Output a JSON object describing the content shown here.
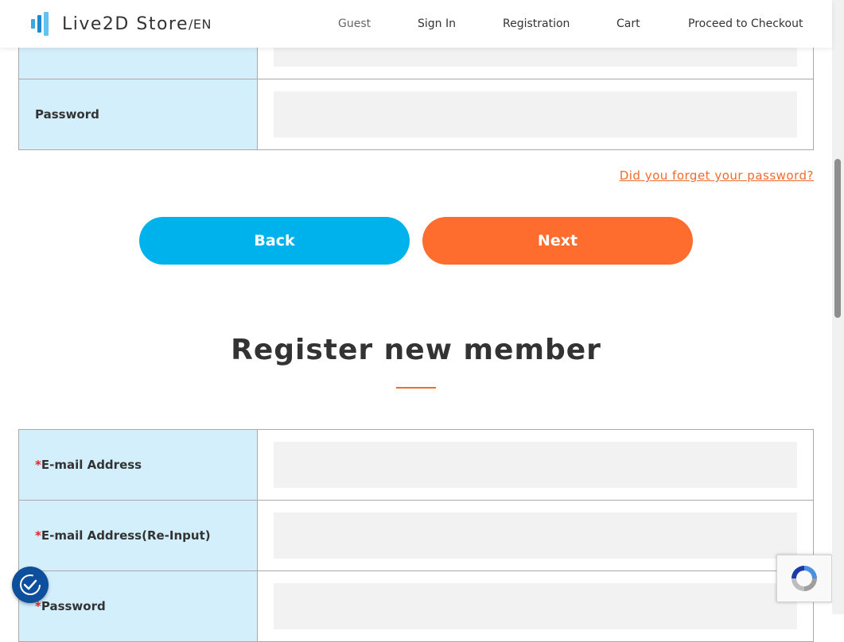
{
  "header": {
    "logo_text": "Live2D Store",
    "logo_suffix": "/EN",
    "nav": {
      "guest": "Guest",
      "sign_in": "Sign In",
      "registration": "Registration",
      "cart": "Cart",
      "checkout": "Proceed to Checkout"
    }
  },
  "login": {
    "password_label": "Password",
    "forgot_link": "Did you forget your password?",
    "back_label": "Back",
    "next_label": "Next"
  },
  "register": {
    "title": "Register new member",
    "required_mark": "*",
    "fields": {
      "email": "E-mail Address",
      "email_reinput": "E-mail Address(Re-Input)",
      "password": "Password"
    }
  },
  "colors": {
    "accent_blue": "#00b2ec",
    "accent_orange": "#ff6d2e",
    "label_bg": "#d3effb",
    "required": "#e3242b"
  },
  "icons": {
    "logo": "live2d-logo-icon",
    "accessibility": "accessibility-icon",
    "recaptcha": "recaptcha-icon"
  }
}
